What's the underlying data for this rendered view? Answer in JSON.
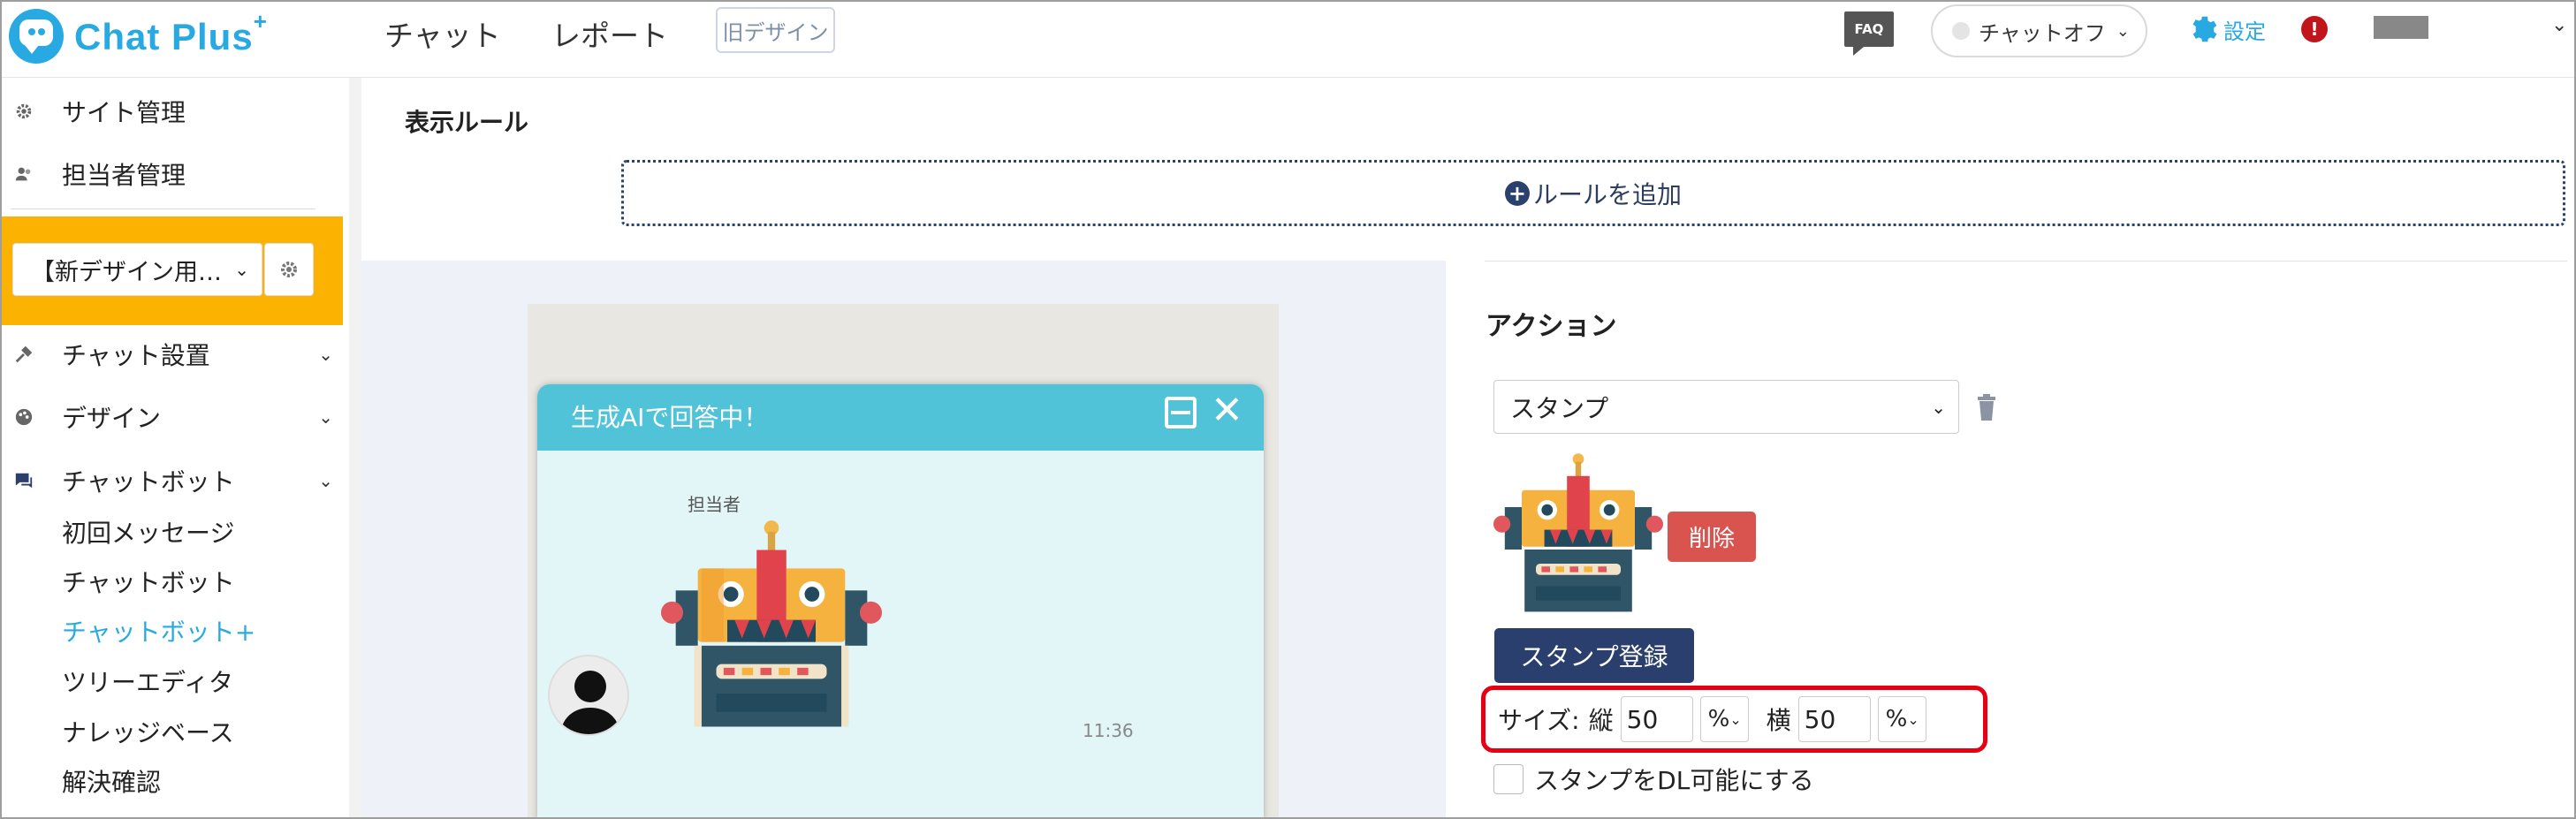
{
  "header": {
    "logo_text": "Chat Plus",
    "logo_sup": "+",
    "nav": [
      "チャット",
      "レポート"
    ],
    "old_design_label": "旧デザイン",
    "faq_label": "FAQ",
    "chat_status": "チャットオフ",
    "settings_label": "設定",
    "alert_mark": "!"
  },
  "sidebar": {
    "top_items": [
      {
        "label": "サイト管理",
        "icon": "gear-icon"
      },
      {
        "label": "担当者管理",
        "icon": "users-icon"
      }
    ],
    "site_select": "【新デザイン用…",
    "groups": [
      {
        "label": "チャット設置",
        "icon": "tools-icon"
      },
      {
        "label": "デザイン",
        "icon": "palette-icon"
      },
      {
        "label": "チャットボット",
        "icon": "chat-icon"
      }
    ],
    "sub_items": [
      "初回メッセージ",
      "チャットボット",
      "チャットボット+",
      "ツリーエディタ",
      "ナレッジベース",
      "解決確認"
    ],
    "active_sub": "チャットボット+"
  },
  "main": {
    "section_title": "表示ルール",
    "add_rule_label": "ルールを追加"
  },
  "preview": {
    "chat_title": "生成AIで回答中！",
    "agent_label": "担当者",
    "time": "11:36"
  },
  "action": {
    "title": "アクション",
    "selected": "スタンプ",
    "delete_label": "削除",
    "register_label": "スタンプ登録",
    "size_label": "サイズ:",
    "height_label": "縦",
    "height_value": "50",
    "height_unit": "%",
    "width_label": "横",
    "width_value": "50",
    "width_unit": "%",
    "download_label": "スタンプをDL可能にする"
  },
  "colors": {
    "brand": "#29a9e1",
    "highlight": "#fbb200",
    "chat_header": "#50c3d9",
    "danger": "#d9534f",
    "primary_button": "#2a3f6e",
    "annotation": "#e60012"
  }
}
